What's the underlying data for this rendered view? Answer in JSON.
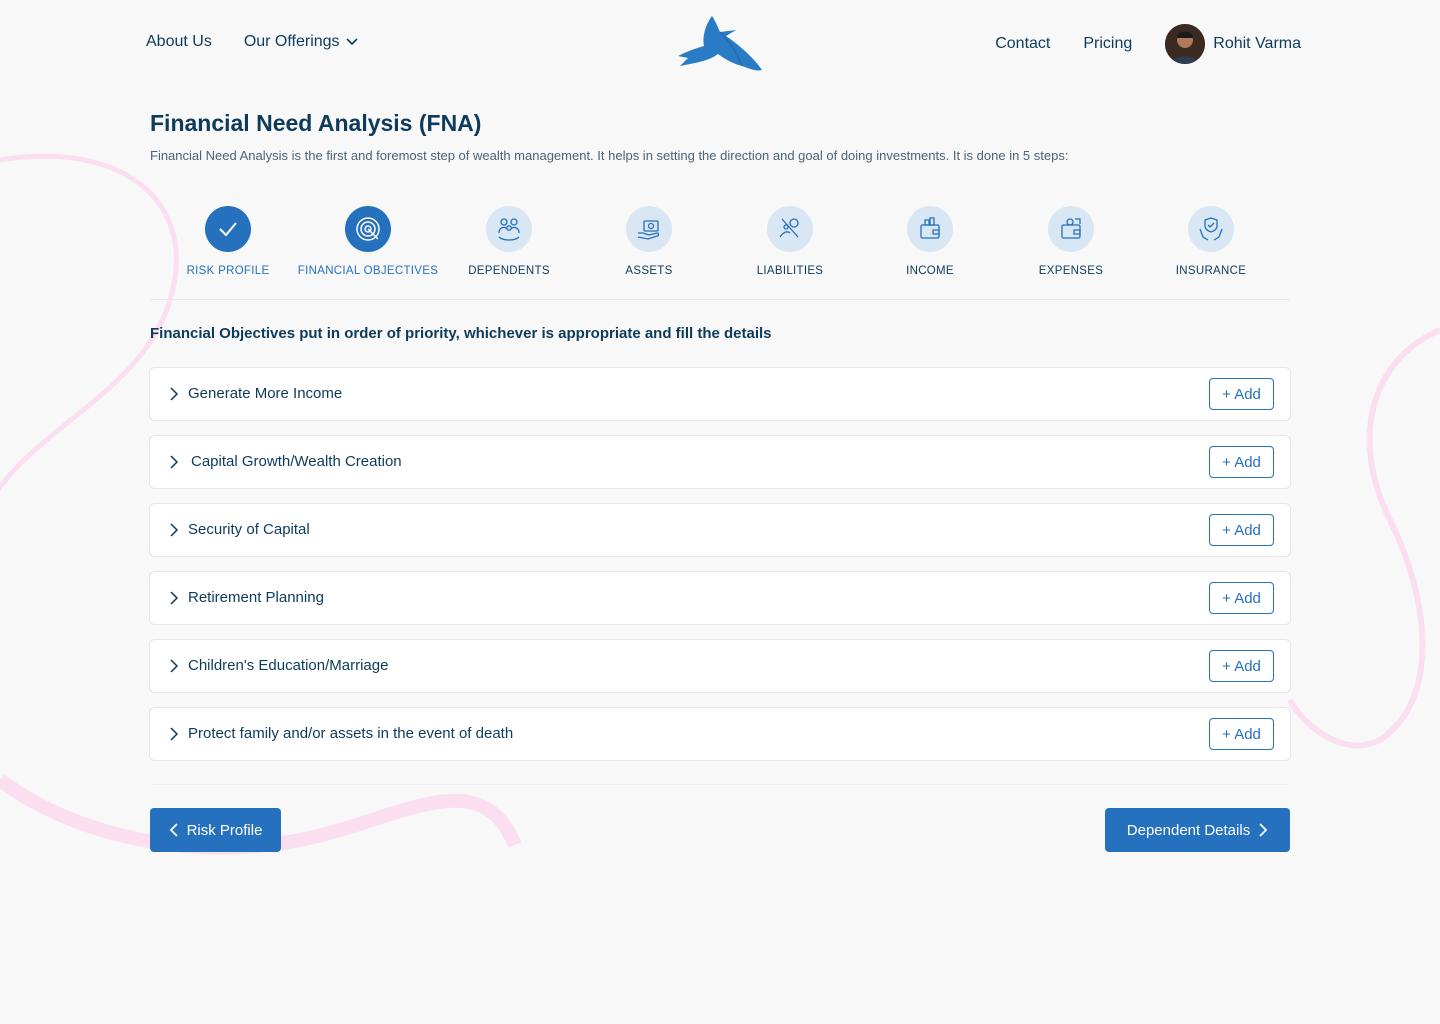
{
  "header": {
    "nav_left": [
      {
        "label": "About Us"
      },
      {
        "label": "Our Offerings"
      }
    ],
    "nav_right": [
      {
        "label": "Contact"
      },
      {
        "label": "Pricing"
      }
    ],
    "user_name": "Rohit Varma"
  },
  "page": {
    "title": "Financial Need Analysis (FNA)",
    "subtitle": "Financial Need Analysis is the first and foremost step of wealth management. It helps in setting the direction and goal of doing investments. It is done in 5 steps:"
  },
  "steps": [
    {
      "label": "RISK PROFILE",
      "state": "done",
      "icon": "check-icon"
    },
    {
      "label": "FINANCIAL OBJECTIVES",
      "state": "active",
      "icon": "target-icon"
    },
    {
      "label": "DEPENDENTS",
      "state": "pending",
      "icon": "family-icon"
    },
    {
      "label": "ASSETS",
      "state": "pending",
      "icon": "money-hand-icon"
    },
    {
      "label": "LIABILITIES",
      "state": "pending",
      "icon": "liability-icon"
    },
    {
      "label": "INCOME",
      "state": "pending",
      "icon": "wallet-icon"
    },
    {
      "label": "EXPENSES",
      "state": "pending",
      "icon": "expenses-wallet-icon"
    },
    {
      "label": "INSURANCE",
      "state": "pending",
      "icon": "shield-hand-icon"
    }
  ],
  "objectives": {
    "heading": "Financial Objectives put in order of priority, whichever is appropriate and fill the details",
    "add_label": "+ Add",
    "items": [
      {
        "label": "Generate More Income"
      },
      {
        "label": "Capital Growth/Wealth Creation"
      },
      {
        "label": "Security of Capital"
      },
      {
        "label": "Retirement Planning"
      },
      {
        "label": "Children's Education/Marriage"
      },
      {
        "label": "Protect family and/or assets in the event of death"
      }
    ]
  },
  "footer": {
    "back_label": "Risk Profile",
    "next_label": "Dependent Details"
  },
  "colors": {
    "primary": "#2571bd",
    "text": "#0d3b5c",
    "step_pending": "#d9e6f3",
    "decor": "#f9d6ee"
  }
}
